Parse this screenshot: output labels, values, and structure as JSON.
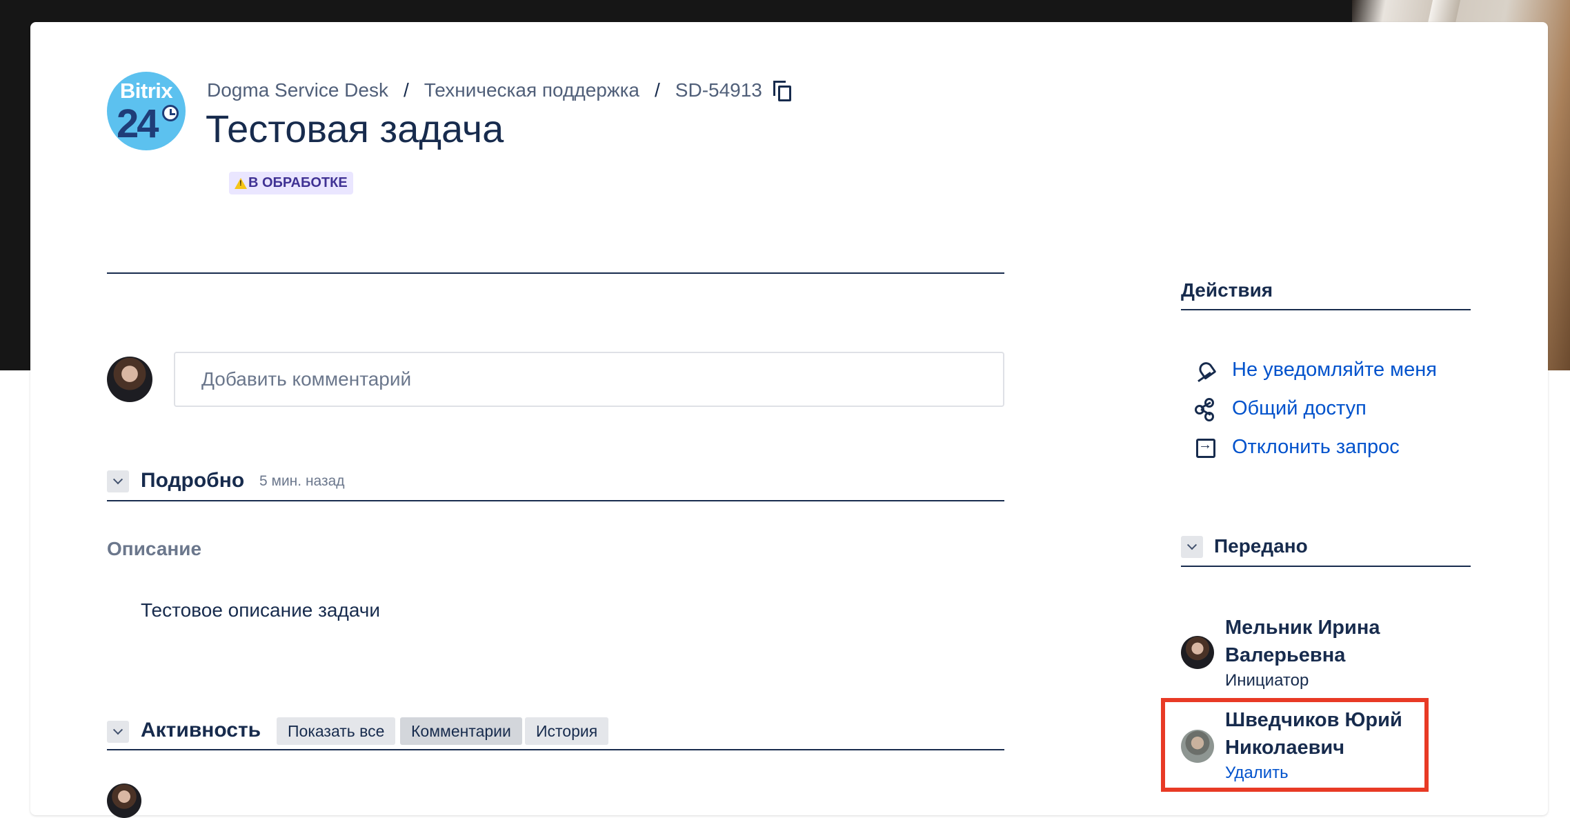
{
  "header": {
    "logo": {
      "line1": "Bitrix",
      "line2": "24"
    },
    "breadcrumb": {
      "project": "Dogma Service Desk",
      "queue": "Техническая поддержка",
      "key": "SD-54913"
    },
    "title": "Тестовая задача",
    "status": "В ОБРАБОТКЕ"
  },
  "comment": {
    "placeholder": "Добавить комментарий"
  },
  "details": {
    "heading": "Подробно",
    "updated": "5 мин. назад",
    "description_label": "Описание",
    "description_text": "Тестовое описание задачи"
  },
  "activity": {
    "heading": "Активность",
    "filters": [
      "Показать все",
      "Комментарии",
      "История"
    ],
    "active_filter": "Комментарии"
  },
  "sidebar": {
    "actions_title": "Действия",
    "actions": [
      {
        "icon": "bell-off-icon",
        "label": "Не уведомляйте меня"
      },
      {
        "icon": "share-icon",
        "label": "Общий доступ"
      },
      {
        "icon": "reject-icon",
        "label": "Отклонить запрос"
      }
    ],
    "shared_title": "Передано",
    "people": [
      {
        "name_line1": "Мельник Ирина",
        "name_line2": "Валерьевна",
        "role": "Инициатор"
      },
      {
        "name_line1": "Шведчиков Юрий",
        "name_line2": "Николаевич",
        "action": "Удалить"
      }
    ]
  },
  "colors": {
    "link": "#0052cc",
    "status_bg": "#eae6ff",
    "status_text": "#403294",
    "highlight": "#e83a25"
  }
}
